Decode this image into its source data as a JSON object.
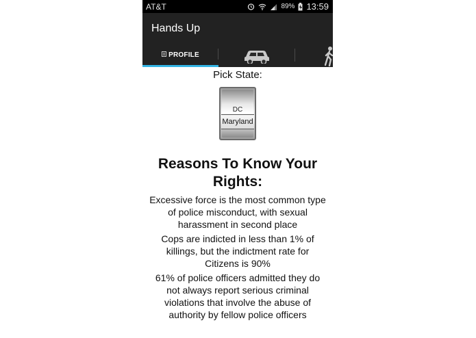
{
  "statusbar": {
    "carrier": "AT&T",
    "battery_pct": "89%",
    "time": "13:59"
  },
  "actionbar": {
    "title": "Hands Up"
  },
  "tabs": [
    {
      "label": "PROFILE",
      "icon": "profile-icon"
    },
    {
      "label": "",
      "icon": "car-icon"
    },
    {
      "label": "",
      "icon": "walking-person-icon"
    }
  ],
  "content": {
    "pick_label": "Pick State:",
    "picker": {
      "above_item": "DC",
      "selected": "Maryland"
    },
    "reasons_title": "Reasons To Know Your Rights:",
    "reasons": [
      "Excessive force is the most common type of police misconduct, with sexual harassment in second place",
      "Cops are indicted in less than 1% of killings, but the indictment rate for Citizens is 90%",
      "61% of police officers admitted they do not always report serious criminal violations that involve the abuse of authority by fellow police officers"
    ]
  },
  "colors": {
    "actionbar_bg": "#222222",
    "tab_indicator": "#33b5e5",
    "statusbar_bg": "#000000"
  }
}
